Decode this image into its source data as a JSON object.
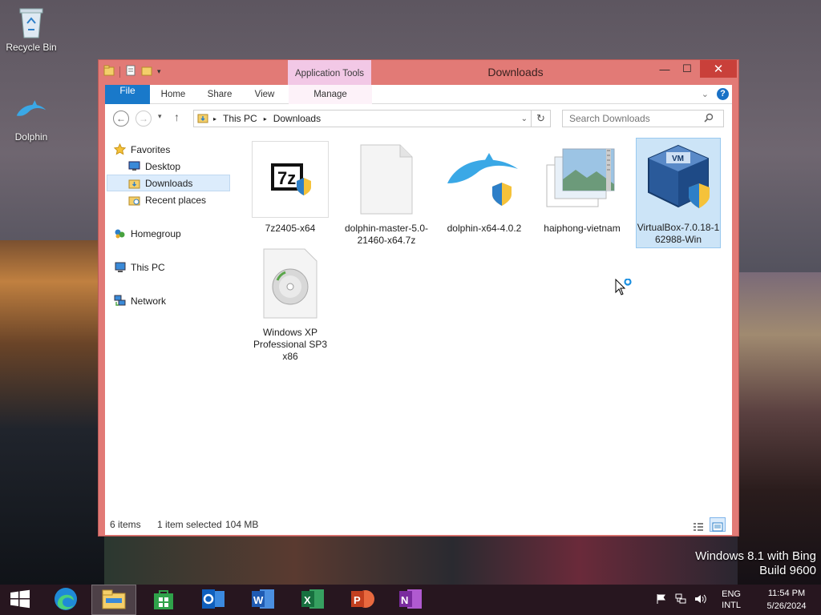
{
  "desktop": {
    "icons": [
      {
        "label": "Recycle Bin",
        "icon": "recycle-bin-icon"
      },
      {
        "label": "Dolphin",
        "icon": "dolphin-icon"
      }
    ],
    "watermark": {
      "line1": "Windows 8.1 with Bing",
      "line2": "Build 9600"
    }
  },
  "window": {
    "title": "Downloads",
    "context_tab": "Application Tools",
    "ribbon_tabs": [
      "File",
      "Home",
      "Share",
      "View",
      "Manage"
    ],
    "address": {
      "segments": [
        "This PC",
        "Downloads"
      ]
    },
    "search": {
      "placeholder": "Search Downloads"
    },
    "navigation": [
      {
        "label": "Favorites",
        "icon": "star-icon"
      },
      {
        "label": "Desktop",
        "icon": "desktop-folder-icon"
      },
      {
        "label": "Downloads",
        "icon": "downloads-folder-icon",
        "selected": true
      },
      {
        "label": "Recent places",
        "icon": "recent-places-icon"
      },
      {
        "label": "Homegroup",
        "icon": "homegroup-icon"
      },
      {
        "label": "This PC",
        "icon": "computer-icon"
      },
      {
        "label": "Network",
        "icon": "network-icon"
      }
    ],
    "files": [
      {
        "name": "7z2405-x64",
        "icon": "7zip-installer-icon"
      },
      {
        "name": "dolphin-master-5.0-21460-x64.7z",
        "icon": "blank-file-icon"
      },
      {
        "name": "dolphin-x64-4.0.2",
        "icon": "dolphin-installer-icon"
      },
      {
        "name": "haiphong-vietnam",
        "icon": "zip-archive-icon"
      },
      {
        "name": "VirtualBox-7.0.18-162988-Win",
        "icon": "virtualbox-installer-icon",
        "selected": true
      },
      {
        "name": "Windows XP Professional SP3 x86",
        "icon": "disc-image-icon"
      }
    ],
    "status": {
      "count": "6 items",
      "selection": "1 item selected",
      "size": "104 MB"
    }
  },
  "taskbar": {
    "apps": [
      "start-icon",
      "edge-icon",
      "file-explorer-icon",
      "store-icon",
      "outlook-icon",
      "word-icon",
      "excel-icon",
      "powerpoint-icon",
      "onenote-icon"
    ],
    "lang_top": "ENG",
    "lang_bottom": "INTL",
    "time": "11:54 PM",
    "date": "5/26/2024"
  },
  "colors": {
    "frame": "#e27a76",
    "accent": "#1979ca",
    "close": "#c9403a",
    "selection": "#cce4f7"
  }
}
